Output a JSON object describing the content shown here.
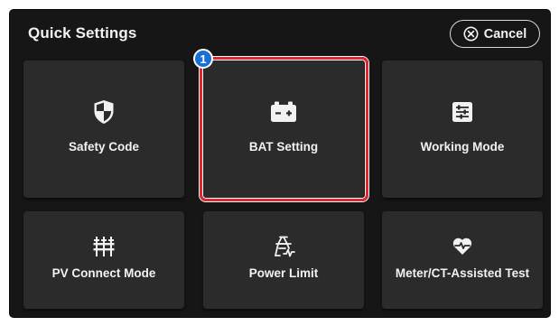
{
  "header": {
    "title": "Quick Settings",
    "cancel_label": "Cancel"
  },
  "tiles": [
    {
      "label": "Safety Code",
      "icon": "shield-icon"
    },
    {
      "label": "BAT Setting",
      "icon": "battery-icon"
    },
    {
      "label": "Working Mode",
      "icon": "sliders-icon"
    },
    {
      "label": "PV Connect Mode",
      "icon": "pv-strings-icon"
    },
    {
      "label": "Power Limit",
      "icon": "power-limit-icon"
    },
    {
      "label": "Meter/CT-Assisted Test",
      "icon": "heart-pulse-icon"
    }
  ],
  "annotation": {
    "step_number": "1",
    "highlighted_tile": "BAT Setting",
    "highlight_color": "#e0262e",
    "badge_color": "#1a6fd0"
  },
  "colors": {
    "background": "#161616",
    "tile": "#2b2b2b",
    "text": "#f2f2f2"
  }
}
